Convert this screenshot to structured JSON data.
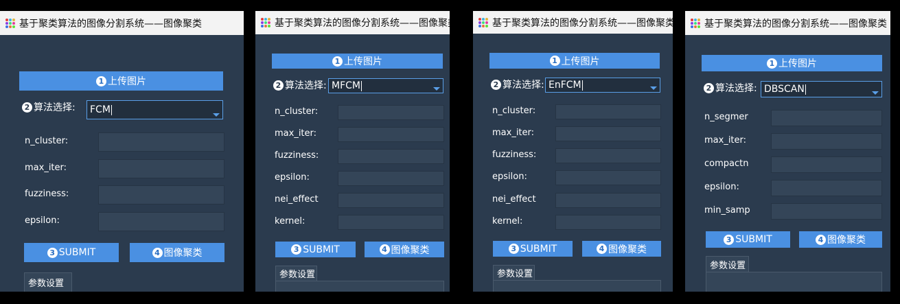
{
  "colors": {
    "accent": "#4a90e2",
    "panel_bg": "#2b3b4e",
    "titlebar_bg": "#f3f3f3"
  },
  "panels": [
    {
      "title": "基于聚类算法的图像分割系统——图像聚类",
      "upload_num": "1",
      "upload_label": "上传图片",
      "algo_num": "2",
      "algo_label": "算法选择:",
      "algo_value": "FCM",
      "params": [
        "n_cluster:",
        "max_iter:",
        "fuzziness:",
        "epsilon:"
      ],
      "submit_num": "3",
      "submit_label": "SUBMIT",
      "cluster_num": "4",
      "cluster_label": "图像聚类",
      "tab_label": "参数设置"
    },
    {
      "title": "基于聚类算法的图像分割系统——图像聚类",
      "upload_num": "1",
      "upload_label": "上传图片",
      "algo_num": "2",
      "algo_label": "算法选择:",
      "algo_value": "MFCM",
      "params": [
        "n_cluster:",
        "max_iter:",
        "fuzziness:",
        "epsilon:",
        "nei_effect",
        "kernel:"
      ],
      "submit_num": "3",
      "submit_label": "SUBMIT",
      "cluster_num": "4",
      "cluster_label": "图像聚类",
      "tab_label": "参数设置"
    },
    {
      "title": "基于聚类算法的图像分割系统——图像聚类",
      "upload_num": "1",
      "upload_label": "上传图片",
      "algo_num": "2",
      "algo_label": "算法选择:",
      "algo_value": "EnFCM",
      "params": [
        "n_cluster:",
        "max_iter:",
        "fuzziness:",
        "epsilon:",
        "nei_effect",
        "kernel:"
      ],
      "submit_num": "3",
      "submit_label": "SUBMIT",
      "cluster_num": "4",
      "cluster_label": "图像聚类",
      "tab_label": "参数设置"
    },
    {
      "title": "基于聚类算法的图像分割系统——图像聚类",
      "upload_num": "1",
      "upload_label": "上传图片",
      "algo_num": "2",
      "algo_label": "算法选择:",
      "algo_value": "DBSCAN",
      "params": [
        "n_segmer",
        "max_iter:",
        "compactn",
        "epsilon:",
        "min_samp"
      ],
      "submit_num": "3",
      "submit_label": "SUBMIT",
      "cluster_num": "4",
      "cluster_label": "图像聚类",
      "tab_label": "参数设置"
    }
  ]
}
